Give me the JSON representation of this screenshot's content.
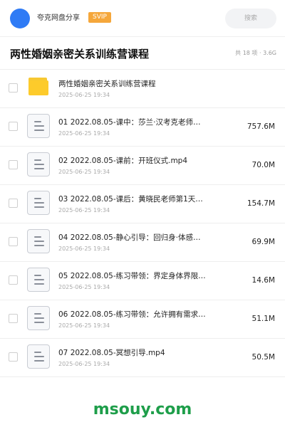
{
  "header": {
    "username": "夸克网盘分享",
    "badge": "SVIP",
    "search_placeholder": "搜索"
  },
  "folder": {
    "title": "两性婚姻亲密关系训练营课程",
    "summary": "共 18 项 · 3.6G"
  },
  "files": [
    {
      "name": "两性婚姻亲密关系训练营课程",
      "date": "2025-06-25 19:34",
      "size": "",
      "type": "folder"
    },
    {
      "name": "01 2022.08.05-课中：莎兰·汉考克老师…",
      "date": "2025-06-25 19:34",
      "size": "757.6M",
      "type": "file"
    },
    {
      "name": "02 2022.08.05-课前：开班仪式.mp4",
      "date": "2025-06-25 19:34",
      "size": "70.0M",
      "type": "file"
    },
    {
      "name": "03 2022.08.05-课后：黄晓民老师第1天…",
      "date": "2025-06-25 19:34",
      "size": "154.7M",
      "type": "file"
    },
    {
      "name": "04 2022.08.05-静心引导：回归身·体感…",
      "date": "2025-06-25 19:34",
      "size": "69.9M",
      "type": "file"
    },
    {
      "name": "05 2022.08.05-练习带领：界定身体界限…",
      "date": "2025-06-25 19:34",
      "size": "14.6M",
      "type": "file"
    },
    {
      "name": "06 2022.08.05-练习带领：允许拥有需求…",
      "date": "2025-06-25 19:34",
      "size": "51.1M",
      "type": "file"
    },
    {
      "name": "07 2022.08.05-冥想引导.mp4",
      "date": "2025-06-25 19:34",
      "size": "50.5M",
      "type": "file"
    }
  ],
  "watermark": "msouy.com",
  "colors": {
    "avatar": "#2f7bf5",
    "svip_badge": "#f5a73b",
    "folder_icon": "#fdcb2b",
    "watermark": "#1e9e4a"
  }
}
